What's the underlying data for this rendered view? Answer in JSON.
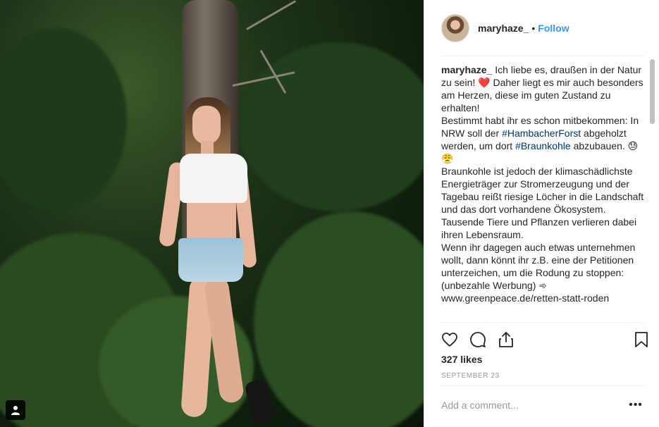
{
  "post": {
    "username": "maryhaze_",
    "separator": "•",
    "follow_label": "Follow",
    "caption": {
      "username": "maryhaze_",
      "part1": " Ich liebe es, draußen in der Natur zu sein! ❤️ Daher liegt es mir auch besonders am Herzen, diese im guten Zustand zu erhalten!\nBestimmt habt ihr es schon mitbekommen: In NRW soll der ",
      "hashtag1": "#HambacherForst",
      "part2": " abgeholzt werden, um dort ",
      "hashtag2": "#Braunkohle",
      "part3": " abzubauen. 😓😤\nBraunkohle ist jedoch der klimaschädlichste Energieträger zur Stromerzeugung und der Tagebau reißt riesige Löcher in die Landschaft und das dort vorhandene Ökosystem. Tausende Tiere und Pflanzen verlieren dabei ihren Lebensraum.\nWenn ihr dagegen auch etwas unternehmen wollt, dann könnt ihr z.B. eine der Petitionen unterzeichen, um die Rodung zu stoppen: (unbezahle Werbung) ➾ www.greenpeace.de/retten-statt-roden"
    },
    "likes_text": "327 likes",
    "date_text": "SEPTEMBER 23",
    "comment_placeholder": "Add a comment...",
    "more_label": "•••"
  },
  "icons": {
    "like": "heart-icon",
    "comment": "comment-bubble-icon",
    "share": "share-icon",
    "save": "bookmark-icon",
    "user_tag": "person-icon"
  },
  "colors": {
    "accent": "#3897f0",
    "hashtag": "#003569",
    "text": "#262626",
    "muted": "#999999"
  }
}
